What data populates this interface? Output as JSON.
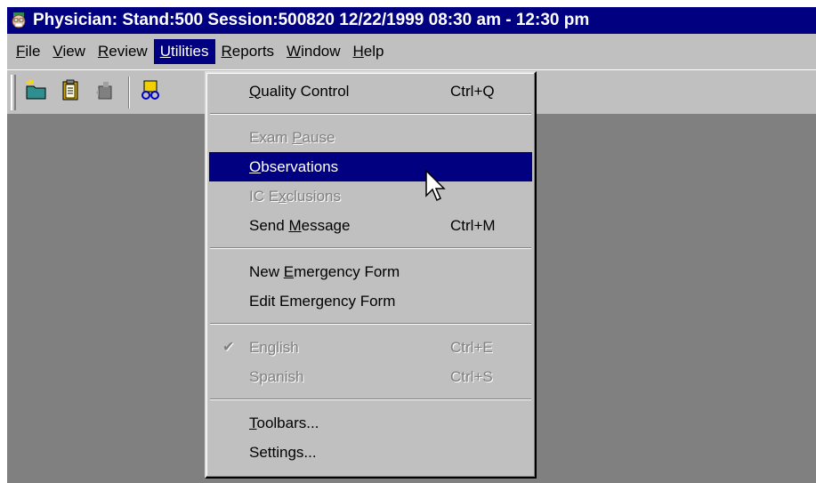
{
  "window": {
    "title": "Physician: Stand:500 Session:500820 12/22/1999 08:30 am - 12:30 pm",
    "app_icon": "physician-face-icon"
  },
  "menubar": {
    "items": [
      {
        "pre": "",
        "key": "F",
        "post": "ile"
      },
      {
        "pre": "",
        "key": "V",
        "post": "iew"
      },
      {
        "pre": "",
        "key": "R",
        "post": "eview"
      },
      {
        "pre": "",
        "key": "U",
        "post": "tilities"
      },
      {
        "pre": "",
        "key": "R",
        "post": "eports"
      },
      {
        "pre": "",
        "key": "W",
        "post": "indow"
      },
      {
        "pre": "",
        "key": "H",
        "post": "elp"
      }
    ],
    "active_index": 3
  },
  "toolbar": {
    "icons": [
      "new-folder-icon",
      "clipboard-icon",
      "exit-icon",
      "group-icon"
    ]
  },
  "utilities_menu": {
    "quality_control": {
      "pre": "",
      "key": "Q",
      "post": "uality Control",
      "shortcut": "Ctrl+Q"
    },
    "exam_pause": {
      "pre": "Exam ",
      "key": "P",
      "post": "ause"
    },
    "observations": {
      "pre": "",
      "key": "O",
      "post": "bservations"
    },
    "ic_exclusions": {
      "pre": "IC E",
      "key": "x",
      "post": "clusions"
    },
    "send_message": {
      "pre": "Send ",
      "key": "M",
      "post": "essage",
      "shortcut": "Ctrl+M"
    },
    "new_emergency_form": {
      "pre": "New ",
      "key": "E",
      "post": "mergency Form"
    },
    "edit_emergency_form": {
      "text": "Edit Emergency Form"
    },
    "english": {
      "text": "English",
      "shortcut": "Ctrl+E",
      "checked": true
    },
    "spanish": {
      "text": "Spanish",
      "shortcut": "Ctrl+S"
    },
    "toolbars": {
      "pre": "",
      "key": "T",
      "post": "oolbars..."
    },
    "settings": {
      "text": "Settings..."
    }
  },
  "colors": {
    "titlebar": "#000080",
    "face": "#c0c0c0",
    "workspace": "#808080",
    "highlight": "#000080"
  }
}
